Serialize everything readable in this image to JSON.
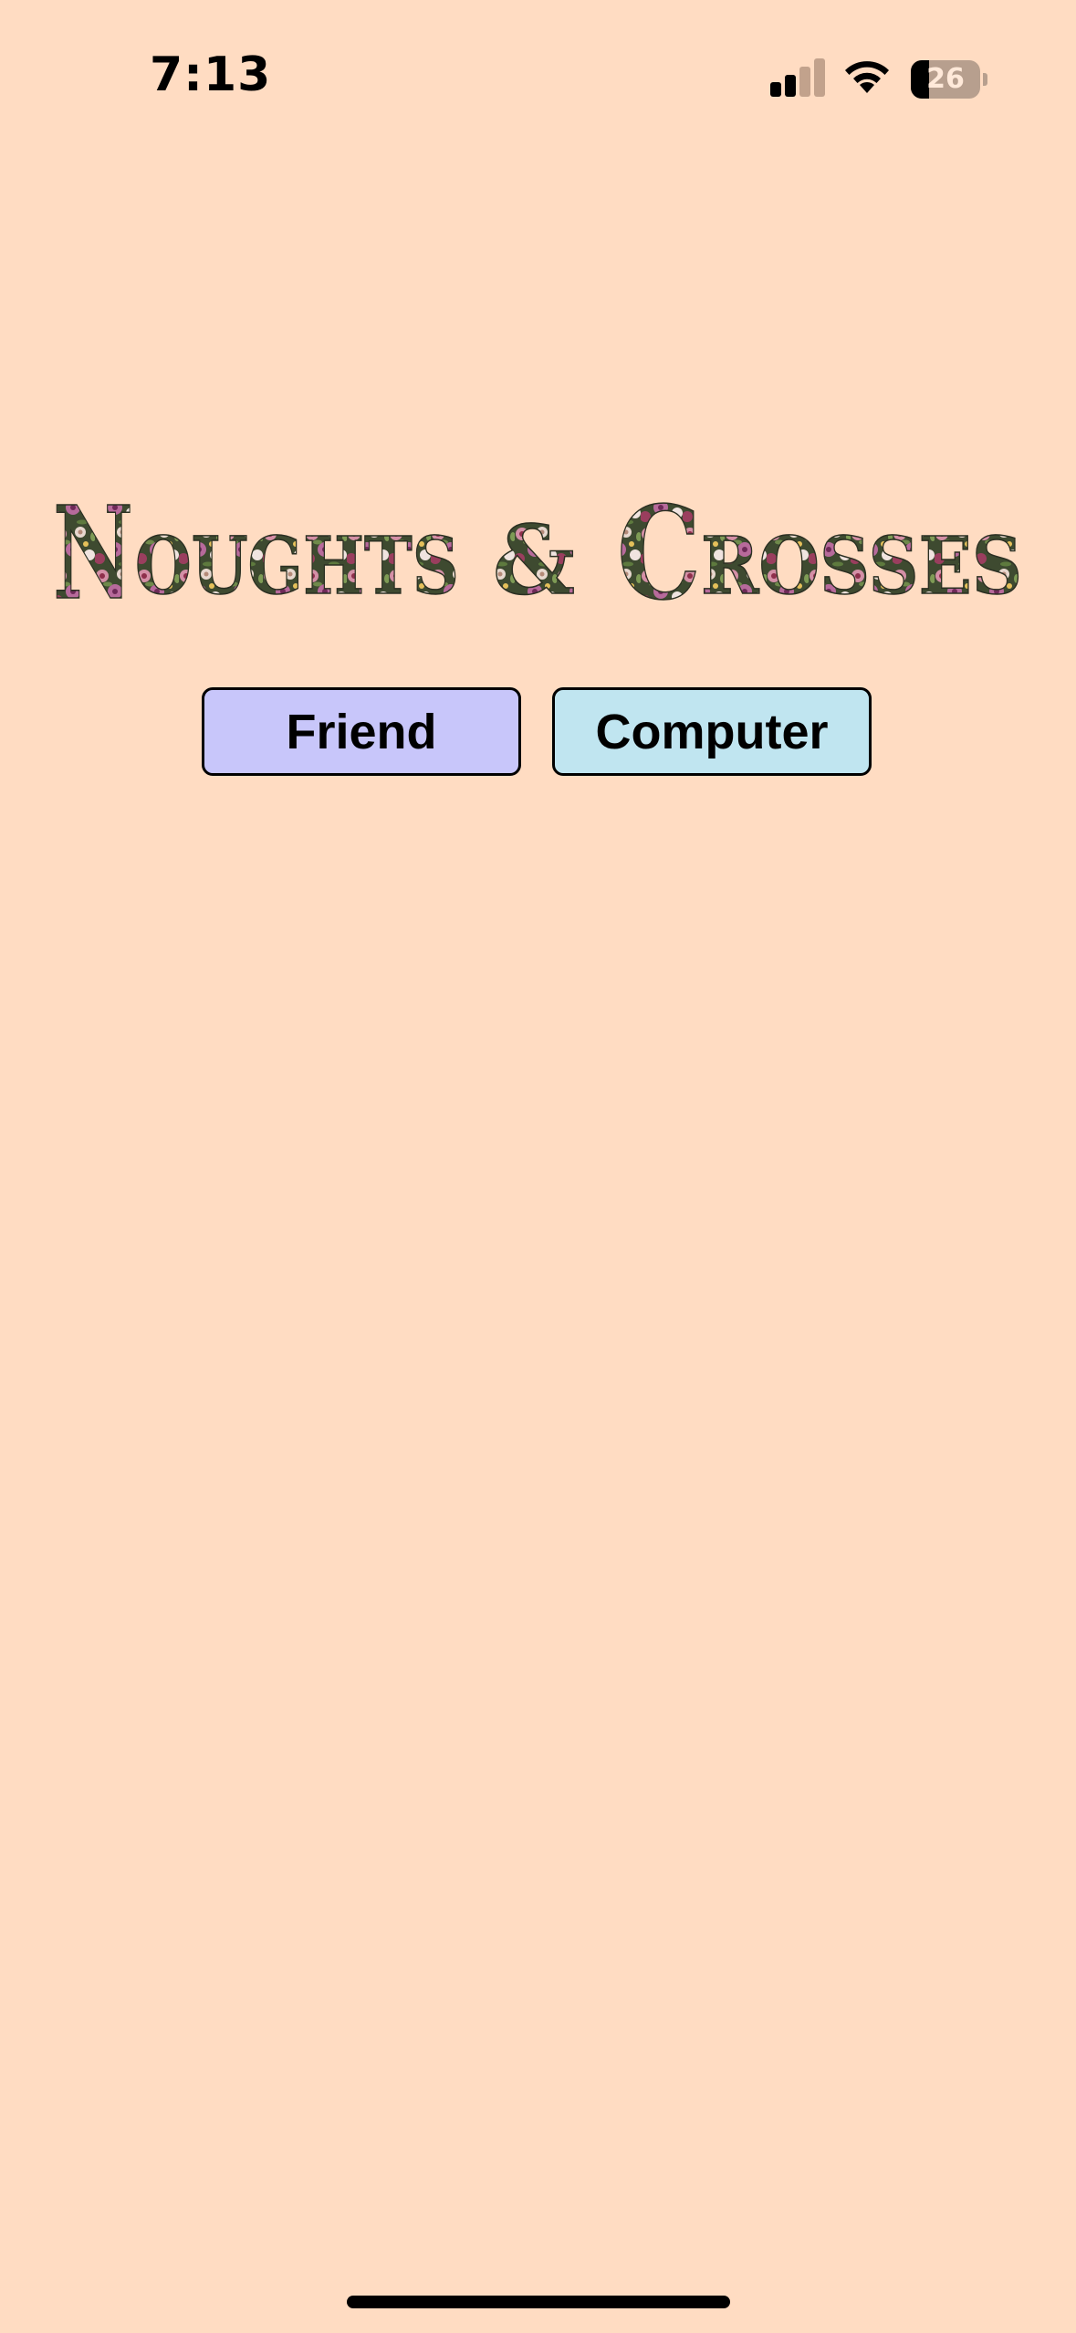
{
  "status_bar": {
    "time": "7:13",
    "battery_level": "26",
    "battery_fraction": 0.26,
    "icons": [
      "cellular-signal-icon",
      "wifi-icon",
      "battery-icon"
    ]
  },
  "title": {
    "text": "Noughts & Crosses",
    "style": "floral-lettering-logo"
  },
  "mode_buttons": {
    "friend_label": "Friend",
    "computer_label": "Computer"
  },
  "colors": {
    "background": "#FFDCC2",
    "friend_button": "#C8C6FA",
    "computer_button": "#C0E5F0",
    "text": "#000000"
  }
}
